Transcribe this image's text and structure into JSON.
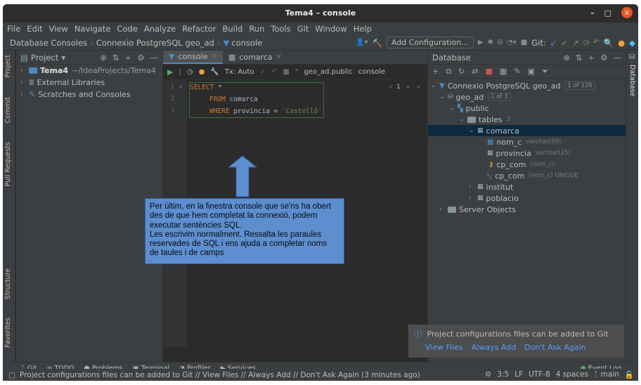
{
  "window": {
    "title": "Tema4 – console"
  },
  "menu": [
    "File",
    "Edit",
    "View",
    "Navigate",
    "Code",
    "Analyze",
    "Refactor",
    "Build",
    "Run",
    "Tools",
    "Git",
    "Window",
    "Help"
  ],
  "breadcrumb": [
    "Database Consoles",
    "Connexio PostgreSQL geo_ad",
    "console"
  ],
  "nav": {
    "add_config": "Add Configuration...",
    "git_label": "Git:"
  },
  "left_stripe": {
    "project": "Project",
    "commit": "Commit",
    "pull_requests": "Pull Requests",
    "structure": "Structure",
    "favorites": "Favorites"
  },
  "project_panel": {
    "title": "Project",
    "items": [
      {
        "name": "Tema4",
        "path": "~/IdeaProjects/Tema4"
      },
      {
        "name": "External Libraries"
      },
      {
        "name": "Scratches and Consoles"
      }
    ]
  },
  "editor": {
    "tabs": [
      "console",
      "comarca"
    ],
    "tx_mode": "Tx: Auto",
    "schema": "geo_ad.public",
    "session": "console",
    "inspection_count": "1",
    "lines": [
      {
        "num": "1",
        "kw": "SELECT",
        "rest": " *"
      },
      {
        "num": "2",
        "kw": "FROM",
        "rest": " comarca"
      },
      {
        "num": "3",
        "kw": "WHERE",
        "rest": " provincia = ",
        "str": "'Castelló'"
      }
    ]
  },
  "callout": {
    "lines": [
      "Per últim, en la finestra console que se'ns ha obert",
      "des de que hem completat la connexió, podem",
      "executar sentències SQL.",
      "Les escrivim normalment. Ressalta les paraules",
      "reservades de SQL i ens ajuda a completar noms",
      "de taules i de camps"
    ]
  },
  "database_panel": {
    "title": "Database",
    "side_label": "Database",
    "connection": {
      "name": "Connexio PostgreSQL geo_ad",
      "badge": "1 of 126"
    },
    "database": {
      "name": "geo_ad",
      "badge": "1 of 3"
    },
    "schema": "public",
    "tables_label": "tables",
    "tables_count": "3",
    "table": "comarca",
    "columns": [
      {
        "name": "nom_c",
        "type": "varchar(50)"
      },
      {
        "name": "provincia",
        "type": "varchar(25)"
      },
      {
        "name": "cp_com",
        "type": "(nom_c)"
      },
      {
        "name": "cp_com",
        "type": "(nom_c) UNIQUE"
      }
    ],
    "other_tables": [
      "institut",
      "poblacio"
    ],
    "server_objects": "Server Objects"
  },
  "notification": {
    "message": "Project configurations files can be added to Git",
    "links": [
      "View Files",
      "Always Add",
      "Don't Ask Again"
    ]
  },
  "bottom_tools": [
    "Git",
    "TODO",
    "Problems",
    "Terminal",
    "Profiler",
    "Services"
  ],
  "event_log": "Event Log",
  "status": {
    "message": "Project configurations files can be added to Git // View Files // Always Add // Don't Ask Again (3 minutes ago)",
    "position": "3:5",
    "line_sep": "LF",
    "encoding": "UTF-8",
    "indent": "4 spaces",
    "branch": "main"
  }
}
